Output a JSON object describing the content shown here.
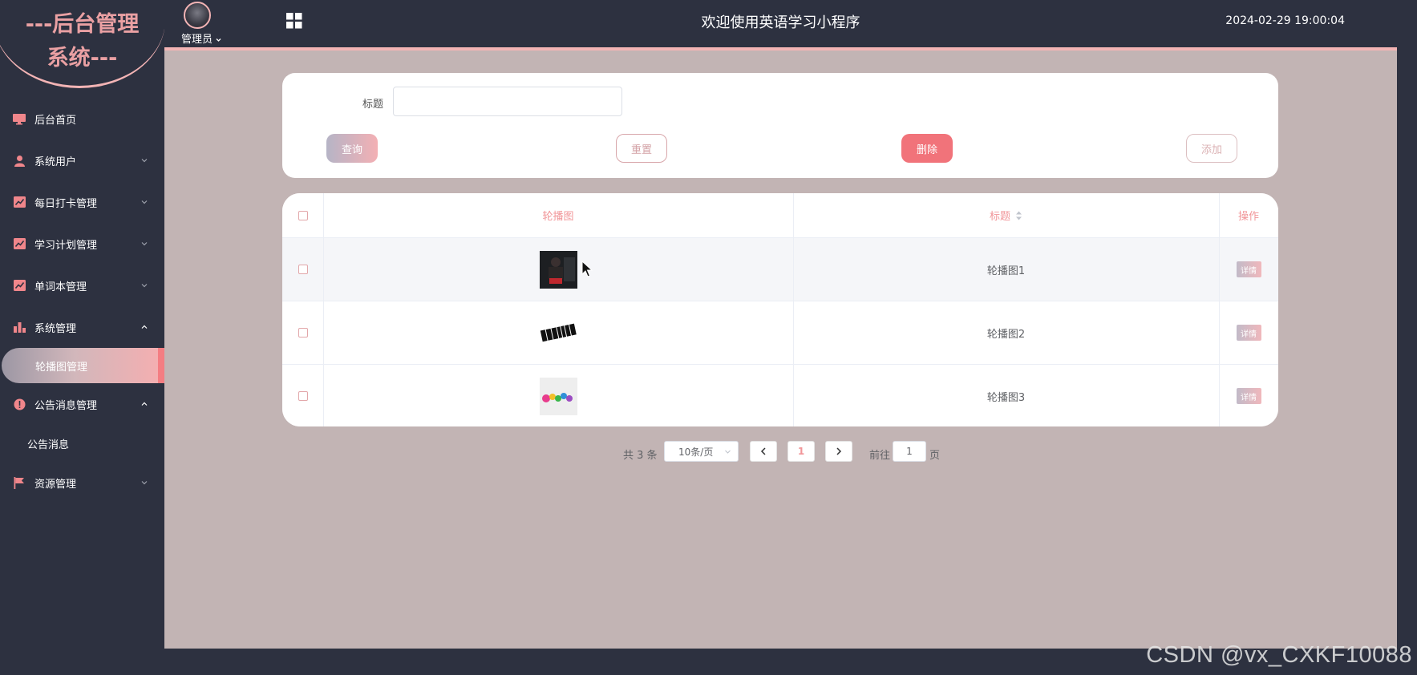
{
  "app": {
    "logo_line1": "---后台管理",
    "logo_line2": "系统---",
    "header_title": "欢迎使用英语学习小程序",
    "admin_label": "管理员",
    "datetime": "2024-02-29 19:00:04"
  },
  "sidebar": {
    "items": [
      {
        "label": "后台首页",
        "icon": "monitor-icon"
      },
      {
        "label": "系统用户",
        "icon": "user-icon"
      },
      {
        "label": "每日打卡管理",
        "icon": "chart-line-icon"
      },
      {
        "label": "学习计划管理",
        "icon": "chart-line-icon"
      },
      {
        "label": "单词本管理",
        "icon": "chart-line-icon"
      },
      {
        "label": "系统管理",
        "icon": "bar-chart-icon"
      },
      {
        "label": "公告消息管理",
        "icon": "info-icon"
      },
      {
        "label": "资源管理",
        "icon": "flag-icon"
      }
    ],
    "sub_active": "轮播图管理",
    "sub_notice": "公告消息"
  },
  "search": {
    "title_label": "标题",
    "title_value": "",
    "query_label": "查询",
    "reset_label": "重置",
    "delete_label": "删除",
    "add_label": "添加"
  },
  "table": {
    "headers": {
      "image": "轮播图",
      "title": "标题",
      "action": "操作"
    },
    "rows": [
      {
        "title": "轮播图1",
        "action": "详情"
      },
      {
        "title": "轮播图2",
        "action": "详情"
      },
      {
        "title": "轮播图3",
        "action": "详情"
      }
    ]
  },
  "pagination": {
    "total_text": "共 3 条",
    "page_size": "10条/页",
    "current_page": "1",
    "goto_label": "前往",
    "goto_value": "1",
    "page_suffix": "页"
  },
  "watermark": "CSDN @vx_CXKF10088",
  "colors": {
    "accent": "#f19598",
    "sidebar_bg": "#2d3140",
    "main_bg": "#c2b4b4",
    "delete": "#f1737a"
  }
}
